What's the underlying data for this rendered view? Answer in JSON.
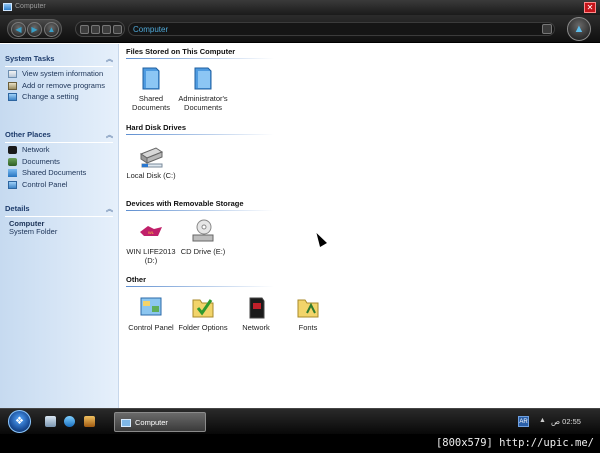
{
  "window": {
    "title": "Computer",
    "address_text": "Computer"
  },
  "sidebar": {
    "system_tasks": {
      "title": "System Tasks",
      "items": [
        {
          "label": "View system information",
          "icon": "system-info-icon"
        },
        {
          "label": "Add or remove programs",
          "icon": "add-remove-icon"
        },
        {
          "label": "Change a setting",
          "icon": "control-panel-icon"
        }
      ]
    },
    "other_places": {
      "title": "Other Places",
      "items": [
        {
          "label": "Network",
          "icon": "network-icon"
        },
        {
          "label": "Documents",
          "icon": "documents-icon"
        },
        {
          "label": "Shared Documents",
          "icon": "shared-documents-icon"
        },
        {
          "label": "Control Panel",
          "icon": "control-panel-icon"
        }
      ]
    },
    "details": {
      "title": "Details",
      "name": "Computer",
      "type": "System Folder"
    }
  },
  "groups": {
    "files_stored": {
      "title": "Files Stored on This Computer",
      "items": [
        {
          "label": "Shared Documents",
          "icon": "blue-folder-icon"
        },
        {
          "label": "Administrator's Documents",
          "icon": "blue-folder-icon"
        }
      ]
    },
    "hard_disks": {
      "title": "Hard Disk Drives",
      "items": [
        {
          "label": "Local Disk (C:)",
          "icon": "hard-disk-icon"
        }
      ]
    },
    "removable": {
      "title": "Devices with Removable Storage",
      "items": [
        {
          "label": "WIN LIFE2013 (D:)",
          "icon": "dvd-drive-icon"
        },
        {
          "label": "CD Drive (E:)",
          "icon": "cd-drive-icon"
        }
      ]
    },
    "other": {
      "title": "Other",
      "items": [
        {
          "label": "Control Panel",
          "icon": "control-panel-icon"
        },
        {
          "label": "Folder Options",
          "icon": "folder-options-icon"
        },
        {
          "label": "Network",
          "icon": "network-icon"
        },
        {
          "label": "Fonts",
          "icon": "fonts-icon"
        }
      ]
    }
  },
  "taskbar": {
    "task_label": "Computer",
    "language": "AR",
    "clock": "02:55 ص"
  },
  "watermark": "[800x579] http://upic.me/",
  "colors": {
    "accent": "#4ea8d8",
    "sidebar_bg": "#d3e3f4",
    "sidebar_text": "#1c3357"
  }
}
